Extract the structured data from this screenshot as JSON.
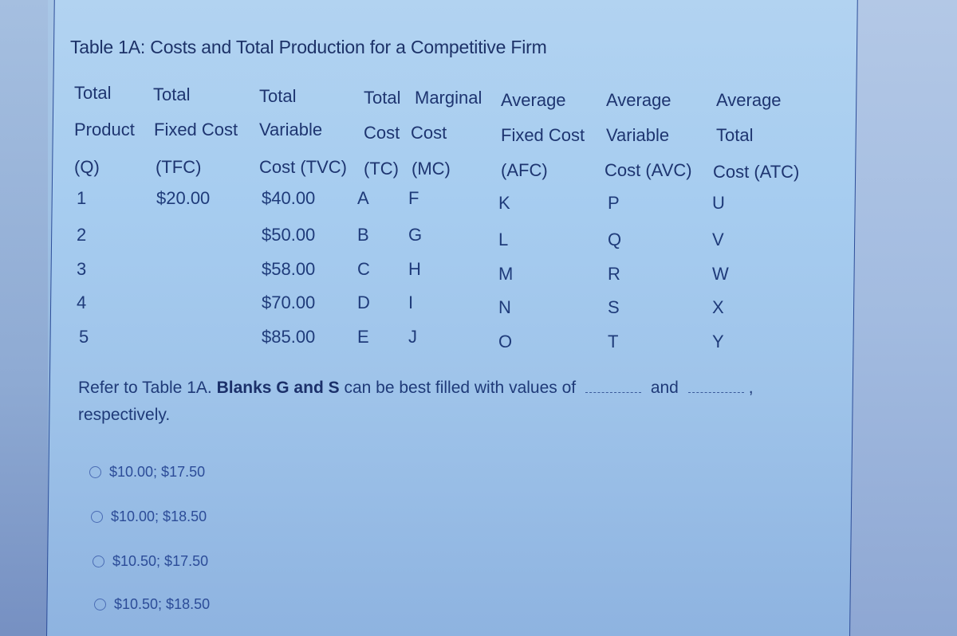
{
  "title": "Table 1A: Costs and Total Production for a Competitive Firm",
  "table": {
    "headers": [
      [
        "Total",
        "Product",
        "(Q)"
      ],
      [
        "Total",
        "Fixed Cost",
        "(TFC)"
      ],
      [
        "Total",
        "Variable",
        "Cost (TVC)"
      ],
      [
        "Total",
        "Cost",
        "(TC)"
      ],
      [
        "Marginal",
        "Cost",
        "(MC)"
      ],
      [
        "Average",
        "Fixed Cost",
        "(AFC)"
      ],
      [
        "Average",
        "Variable",
        "Cost (AVC)"
      ],
      [
        "Average",
        "Total",
        "Cost (ATC)"
      ]
    ],
    "rows": [
      [
        "1",
        "$20.00",
        "$40.00",
        "A",
        "F",
        "K",
        "P",
        "U"
      ],
      [
        "2",
        "",
        "$50.00",
        "B",
        "G",
        "L",
        "Q",
        "V"
      ],
      [
        "3",
        "",
        "$58.00",
        "C",
        "H",
        "M",
        "R",
        "W"
      ],
      [
        "4",
        "",
        "$70.00",
        "D",
        "I",
        "N",
        "S",
        "X"
      ],
      [
        "5",
        "",
        "$85.00",
        "E",
        "J",
        "O",
        "T",
        "Y"
      ]
    ]
  },
  "question": {
    "prefix": "Refer to Table 1A.",
    "bold": "Blanks G and S",
    "middle": "can be best filled with values of",
    "and": "and",
    "suffix": ",",
    "line2": "respectively."
  },
  "options": [
    {
      "label": "$10.00; $17.50",
      "selected": false
    },
    {
      "label": "$10.00; $18.50",
      "selected": false
    },
    {
      "label": "$10.50; $17.50",
      "selected": false
    },
    {
      "label": "$10.50; $18.50",
      "selected": false
    }
  ]
}
